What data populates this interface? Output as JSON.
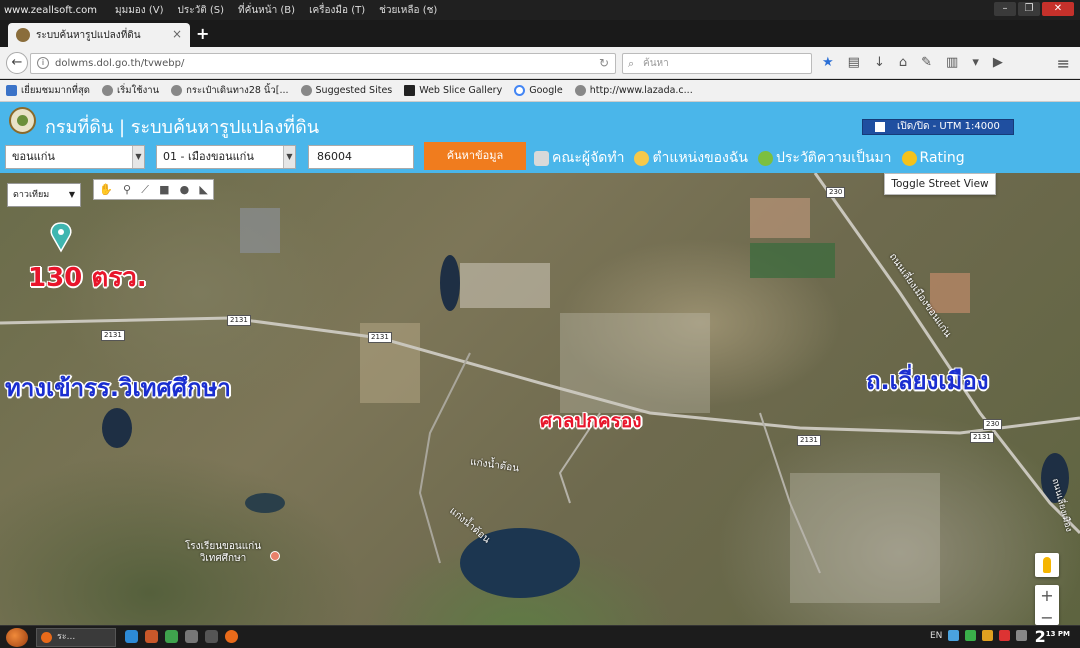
{
  "window": {
    "site_label": "www.zeallsoft.com",
    "menu": [
      "มุมมอง (V)",
      "ประวัติ (S)",
      "ที่คั่นหน้า (B)",
      "เครื่องมือ (T)",
      "ช่วยเหลือ (ช)"
    ]
  },
  "tab": {
    "title": "ระบบค้นหารูปแปลงที่ดิน"
  },
  "address": {
    "url": "dolwms.dol.go.th/tvwebp/",
    "search_placeholder": "ค้นหา"
  },
  "bookmarks": [
    "เยี่ยมชมมากที่สุด",
    "เริ่มใช้งาน",
    "กระเป๋าเดินทาง28 นิ้ว[...",
    "Suggested Sites",
    "Web Slice Gallery",
    "Google",
    "http://www.lazada.c..."
  ],
  "app": {
    "title": "กรมที่ดิน | ระบบค้นหารูปแปลงที่ดิน",
    "utm_toggle": "เปิด/ปิด - UTM 1:4000",
    "province": "ขอนแก่น",
    "district": "01 - เมืองขอนแก่น",
    "parcel_no": "86004",
    "search_button": "ค้นหาข้อมูล",
    "links": [
      "คณะผู้จัดทำ",
      "ตำแหน่งของฉัน",
      "ประวัติความเป็นมา",
      "Rating"
    ]
  },
  "map": {
    "map_type": "ดาวเทียม",
    "street_view_button": "Toggle Street View",
    "annotations": {
      "area": "130 ตรว.",
      "entrance": "ทางเข้ารร.วิเทศศึกษา",
      "court": "ศาลปกครอง",
      "road": "ถ.เลี่ยงเมือง"
    },
    "place_labels": {
      "school": "โรงเรียนขอนแก่น\nวิเทศศึกษา",
      "pond1": "แก่งน้ำต้อน",
      "pond2": "แก่งน้ำต้อน",
      "bypass": "ถนนเลี่ยงเมืองขอนแก่น",
      "bypass2": "ถนนเลี่ยงเมือง"
    },
    "road_shields": [
      "2131",
      "2131",
      "2131",
      "230",
      "230",
      "2131",
      "2131"
    ],
    "zoom_in": "+",
    "zoom_out": "−"
  },
  "taskbar": {
    "task_label": "ระ...",
    "lang": "EN",
    "time": "2",
    "time_small": "13 PM"
  }
}
